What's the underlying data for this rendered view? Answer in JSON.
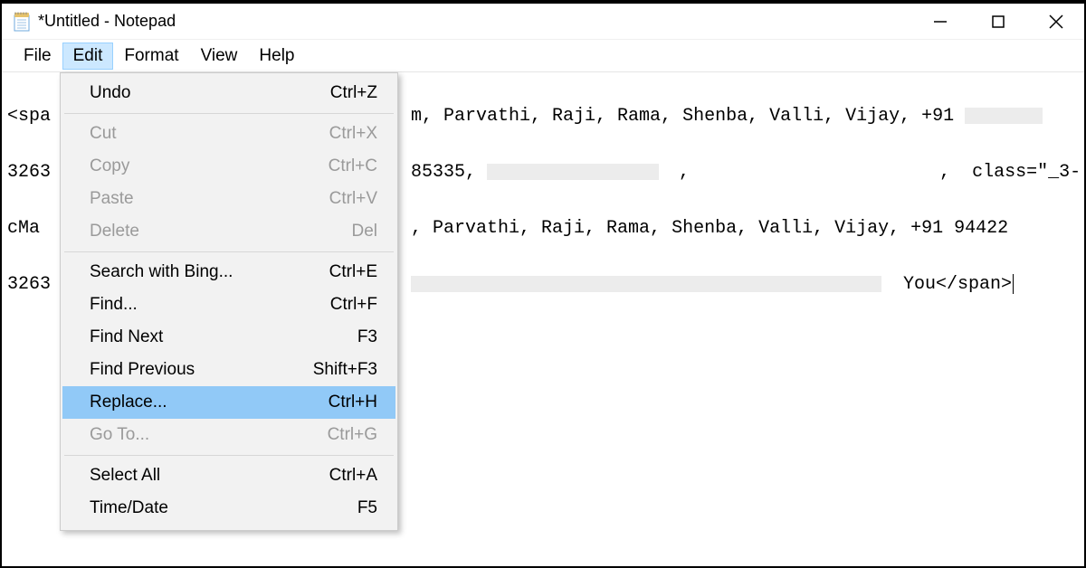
{
  "window": {
    "title": "*Untitled - Notepad"
  },
  "menubar": {
    "file": "File",
    "edit": "Edit",
    "format": "Format",
    "view": "View",
    "help": "Help"
  },
  "dropdown": {
    "undo": {
      "label": "Undo",
      "shortcut": "Ctrl+Z"
    },
    "cut": {
      "label": "Cut",
      "shortcut": "Ctrl+X"
    },
    "copy": {
      "label": "Copy",
      "shortcut": "Ctrl+C"
    },
    "paste": {
      "label": "Paste",
      "shortcut": "Ctrl+V"
    },
    "delete": {
      "label": "Delete",
      "shortcut": "Del"
    },
    "searchbing": {
      "label": "Search with Bing...",
      "shortcut": "Ctrl+E"
    },
    "find": {
      "label": "Find...",
      "shortcut": "Ctrl+F"
    },
    "findnext": {
      "label": "Find Next",
      "shortcut": "F3"
    },
    "findprev": {
      "label": "Find Previous",
      "shortcut": "Shift+F3"
    },
    "replace": {
      "label": "Replace...",
      "shortcut": "Ctrl+H"
    },
    "goto": {
      "label": "Go To...",
      "shortcut": "Ctrl+G"
    },
    "selectall": {
      "label": "Select All",
      "shortcut": "Ctrl+A"
    },
    "timedate": {
      "label": "Time/Date",
      "shortcut": "F5"
    }
  },
  "text": {
    "l1a": "<spa",
    "l1b": "m, Parvathi, Raji, Rama, Shenba, Valli, Vijay, +91 ",
    "l2a": "3263",
    "l2b": "85335,",
    "l2c": "class=\"_3-",
    "l3a": "cMa",
    "l3b": ", Parvathi, Raji, Rama, Shenba, Valli, Vijay, +91 94422",
    "l4a": "3263",
    "l4b": "You</span>"
  }
}
